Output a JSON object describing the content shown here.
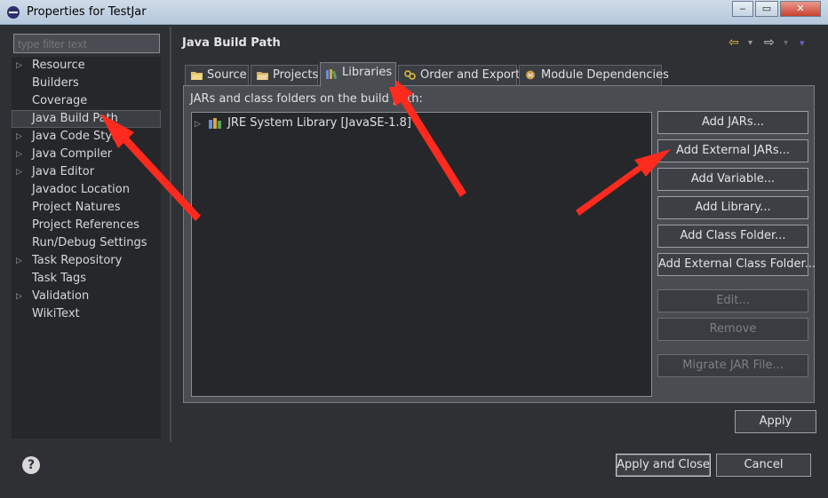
{
  "window": {
    "title": "Properties for TestJar",
    "minimize": "‒",
    "restore": "▭",
    "close": "✕"
  },
  "filter": {
    "placeholder": "type filter text"
  },
  "tree": [
    {
      "label": "Resource",
      "expandable": true
    },
    {
      "label": "Builders",
      "expandable": false
    },
    {
      "label": "Coverage",
      "expandable": false
    },
    {
      "label": "Java Build Path",
      "expandable": false,
      "selected": true
    },
    {
      "label": "Java Code Style",
      "expandable": true
    },
    {
      "label": "Java Compiler",
      "expandable": true
    },
    {
      "label": "Java Editor",
      "expandable": true
    },
    {
      "label": "Javadoc Location",
      "expandable": false
    },
    {
      "label": "Project Natures",
      "expandable": false
    },
    {
      "label": "Project References",
      "expandable": false
    },
    {
      "label": "Run/Debug Settings",
      "expandable": false
    },
    {
      "label": "Task Repository",
      "expandable": true
    },
    {
      "label": "Task Tags",
      "expandable": false
    },
    {
      "label": "Validation",
      "expandable": true
    },
    {
      "label": "WikiText",
      "expandable": false
    }
  ],
  "page": {
    "title": "Java Build Path"
  },
  "nav": {
    "back": "⇦",
    "forward": "⇨",
    "dropdown": "▾",
    "menu": "▾"
  },
  "tabs": [
    {
      "label": "Source",
      "icon": "source-folder-icon"
    },
    {
      "label": "Projects",
      "icon": "projects-folder-icon"
    },
    {
      "label": "Libraries",
      "icon": "libraries-icon",
      "active": true
    },
    {
      "label": "Order and Export",
      "icon": "order-export-icon"
    },
    {
      "label": "Module Dependencies",
      "icon": "module-dependencies-icon"
    }
  ],
  "libraries": {
    "label": "JARs and class folders on the build path:",
    "items": [
      {
        "label": "JRE System Library [JavaSE-1.8]",
        "expand": "▷"
      }
    ],
    "buttons": {
      "add_jars": "Add JARs...",
      "add_external_jars": "Add External JARs...",
      "add_variable": "Add Variable...",
      "add_library": "Add Library...",
      "add_class_folder": "Add Class Folder...",
      "add_external_class_folder": "Add External Class Folder...",
      "edit": "Edit...",
      "remove": "Remove",
      "migrate_jar": "Migrate JAR File..."
    }
  },
  "footer": {
    "apply": "Apply",
    "apply_and_close": "Apply and Close",
    "cancel": "Cancel",
    "help": "?"
  },
  "colors": {
    "accent_arrow": "#ff2a1e",
    "background": "#2e3034",
    "panel": "#25272a"
  }
}
